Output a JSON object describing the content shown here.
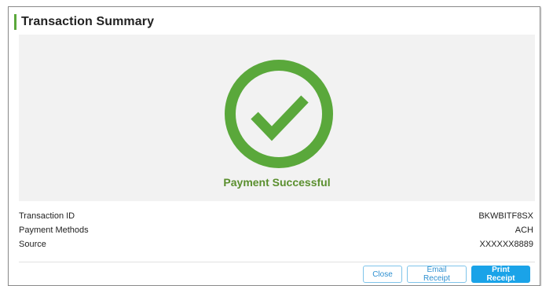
{
  "modal": {
    "title": "Transaction Summary",
    "accent_color": "#5aa83b"
  },
  "status": {
    "icon": "check-circle-icon",
    "message": "Payment Successful",
    "color": "#5a8f2e"
  },
  "details": [
    {
      "label": "Transaction ID",
      "value": "BKWBITF8SX"
    },
    {
      "label": "Payment Methods",
      "value": "ACH"
    },
    {
      "label": "Source",
      "value": "XXXXXX8889"
    }
  ],
  "buttons": {
    "close": "Close",
    "email_receipt": "Email Receipt",
    "print_receipt": "Print Receipt"
  },
  "colors": {
    "primary": "#1aa3e8",
    "success": "#5aa83b"
  }
}
